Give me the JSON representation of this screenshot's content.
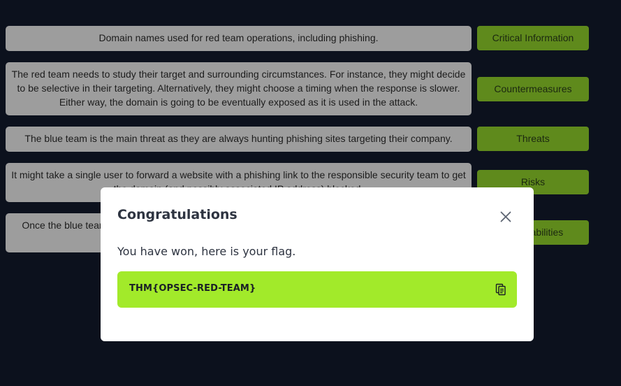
{
  "rows": [
    {
      "description": "Domain names used for red team operations, including phishing.",
      "category": "Critical Information"
    },
    {
      "description": "The red team needs to study their target and surrounding circumstances. For instance, they might decide to be selective in their targeting. Alternatively, they might choose a timing when the response is slower. Either way, the domain is going to be eventually exposed as it is used in the attack.",
      "category": "Countermeasures"
    },
    {
      "description": "The blue team is the main threat as they are always hunting phishing sites targeting their company.",
      "category": "Threats"
    },
    {
      "description": "It might take a single user to forward a website with a phishing link to the responsible security team to get the domain (and possibly associated IP address) blocked.",
      "category": "Risks"
    },
    {
      "description": "Once the blue team has detected the phishing domain, they can block it at the firewall and perimeter level.",
      "category": "Vulnerabilities"
    }
  ],
  "modal": {
    "title": "Congratulations",
    "message": "You have won, here is your flag.",
    "flag": "THM{OPSEC-RED-TEAM}"
  },
  "icons": {
    "close": "close-icon",
    "copy": "copy-icon"
  },
  "colors": {
    "background": "#0c111d",
    "description_card": "#9d9d9d",
    "category_button": "#5f8a1c",
    "flag_box": "#a2ea2a",
    "modal_text": "#2e3441"
  }
}
